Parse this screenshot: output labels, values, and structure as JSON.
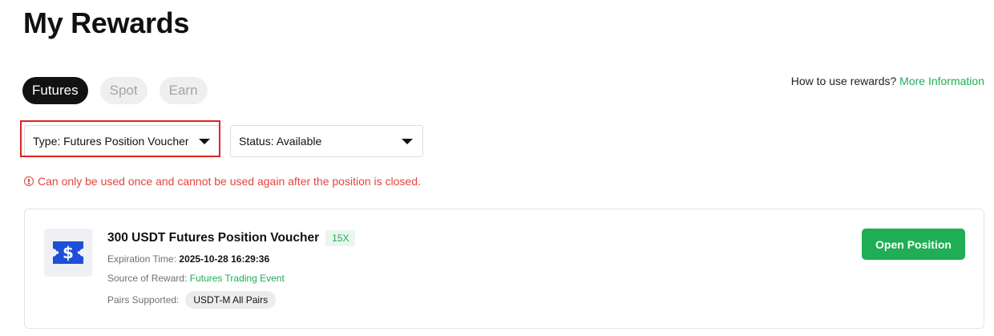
{
  "page": {
    "title": "My Rewards"
  },
  "tabs": [
    {
      "label": "Futures",
      "active": true
    },
    {
      "label": "Spot",
      "active": false
    },
    {
      "label": "Earn",
      "active": false
    }
  ],
  "help": {
    "question": "How to use rewards?",
    "link_label": "More Information"
  },
  "filters": {
    "type_label": "Type: Futures Position Voucher",
    "status_label": "Status: Available"
  },
  "warning": {
    "text": "Can only be used once and cannot be used again after the position is closed.",
    "icon": "alert-circle-icon"
  },
  "voucher": {
    "icon": "voucher-ticket-icon",
    "title": "300 USDT Futures Position Voucher",
    "leverage": "15X",
    "expiration_label": "Expiration Time:",
    "expiration_value": "2025-10-28 16:29:36",
    "source_label": "Source of Reward:",
    "source_value": "Futures Trading Event",
    "pairs_label": "Pairs Supported:",
    "pairs_value": "USDT-M All Pairs",
    "action_label": "Open Position"
  },
  "colors": {
    "accent_green": "#1fae55",
    "warning_red": "#e5443b",
    "highlight_red": "#e0231f",
    "voucher_blue": "#1f4fd8"
  }
}
